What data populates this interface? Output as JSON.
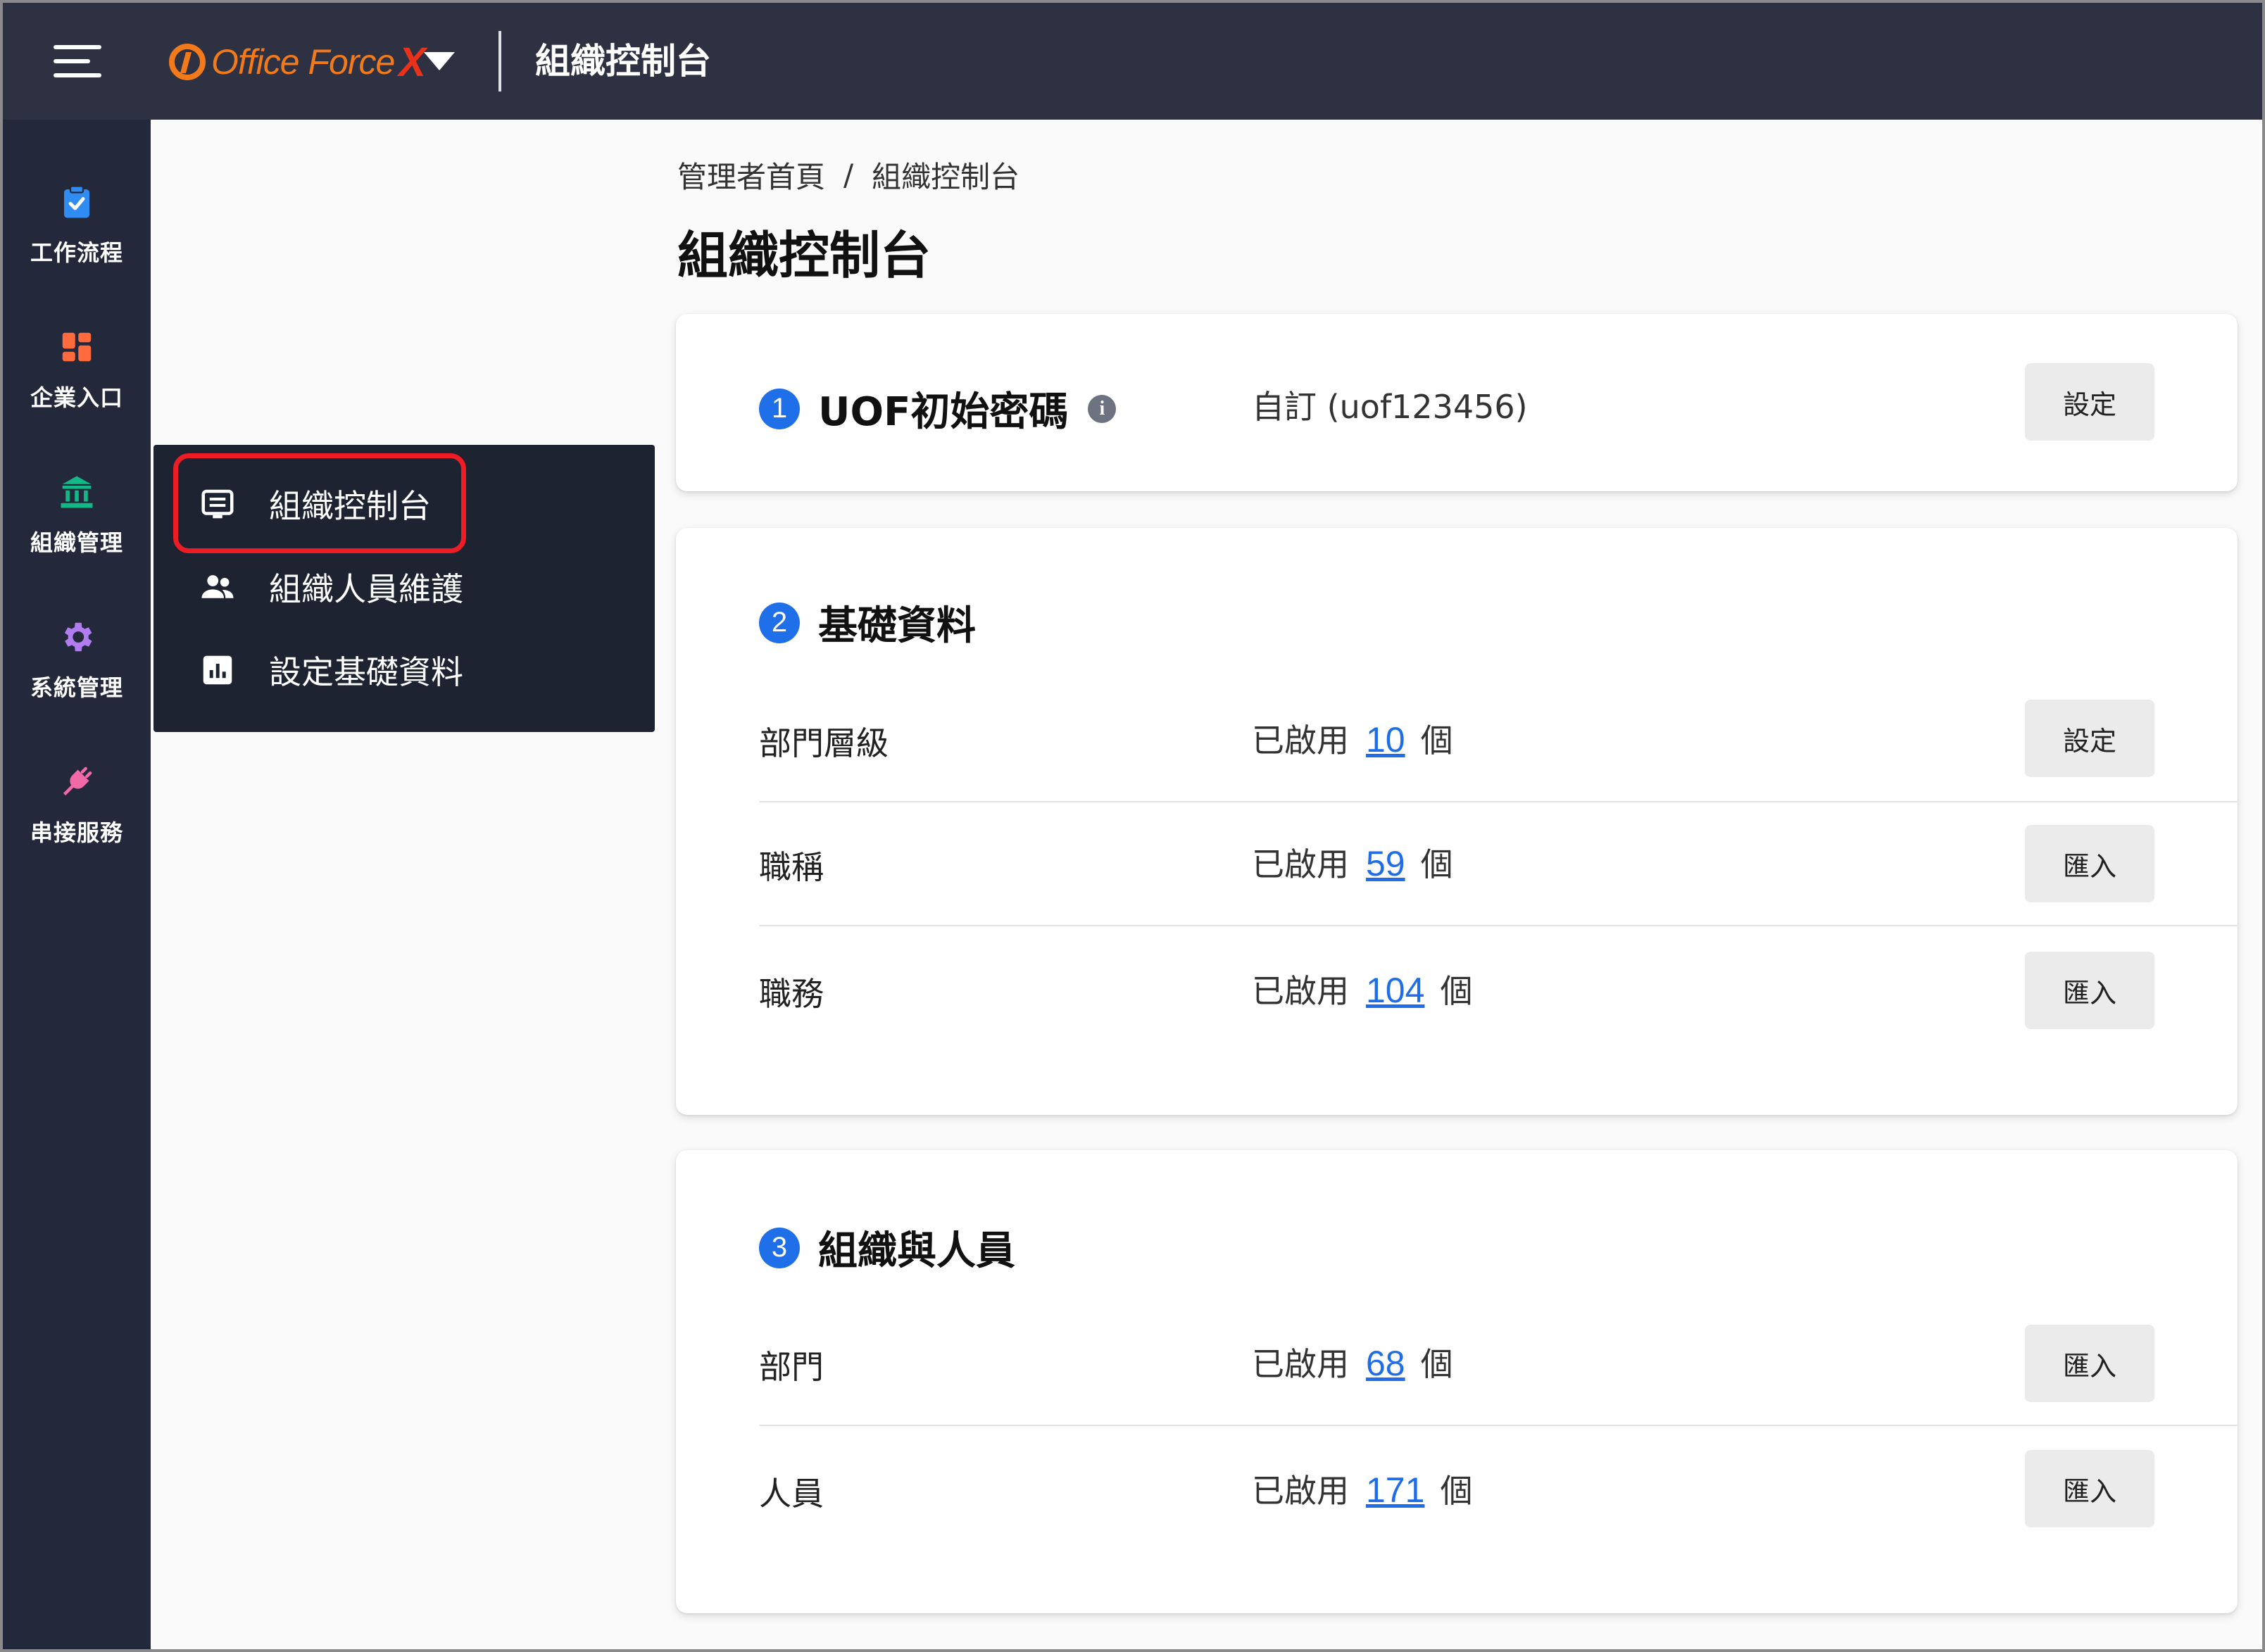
{
  "topbar": {
    "logo_text": "Office Force",
    "logo_x": "X",
    "title": "組織控制台"
  },
  "rail": {
    "items": [
      {
        "label": "工作流程",
        "icon": "clipboard-check-icon",
        "color": "#2f8cf2"
      },
      {
        "label": "企業入口",
        "icon": "dashboard-grid-icon",
        "color": "#ff6b3d"
      },
      {
        "label": "組織管理",
        "icon": "bank-building-icon",
        "color": "#12b886"
      },
      {
        "label": "系統管理",
        "icon": "gear-icon",
        "color": "#b07cf0"
      },
      {
        "label": "串接服務",
        "icon": "plug-icon",
        "color": "#f06aa8"
      }
    ]
  },
  "flyout": {
    "items": [
      {
        "label": "組織控制台",
        "icon": "console-list-icon"
      },
      {
        "label": "組織人員維護",
        "icon": "people-icon"
      },
      {
        "label": "設定基礎資料",
        "icon": "bar-chart-icon"
      }
    ],
    "highlight_color": "#ee1d25"
  },
  "breadcrumb": {
    "home": "管理者首頁",
    "separator": "/",
    "current": "組織控制台"
  },
  "page_title": "組織控制台",
  "cards": {
    "password": {
      "number": "1",
      "title": "UOF初始密碼",
      "value": "自訂 (uof123456)",
      "button": "設定"
    },
    "basic": {
      "number": "2",
      "title": "基礎資料",
      "rows": [
        {
          "label": "部門層級",
          "prefix": "已啟用",
          "count": "10",
          "suffix": "個",
          "button": "設定"
        },
        {
          "label": "職稱",
          "prefix": "已啟用",
          "count": "59",
          "suffix": "個",
          "button": "匯入"
        },
        {
          "label": "職務",
          "prefix": "已啟用",
          "count": "104",
          "suffix": "個",
          "button": "匯入"
        }
      ]
    },
    "org": {
      "number": "3",
      "title": "組織與人員",
      "rows": [
        {
          "label": "部門",
          "prefix": "已啟用",
          "count": "68",
          "suffix": "個",
          "button": "匯入"
        },
        {
          "label": "人員",
          "prefix": "已啟用",
          "count": "171",
          "suffix": "個",
          "button": "匯入"
        }
      ]
    }
  },
  "colors": {
    "topbar_bg": "#2d3142",
    "rail_bg": "#23283a",
    "flyout_bg": "#1e2332",
    "accent_blue": "#1e6fe8",
    "brand_orange": "#f27a1a"
  }
}
